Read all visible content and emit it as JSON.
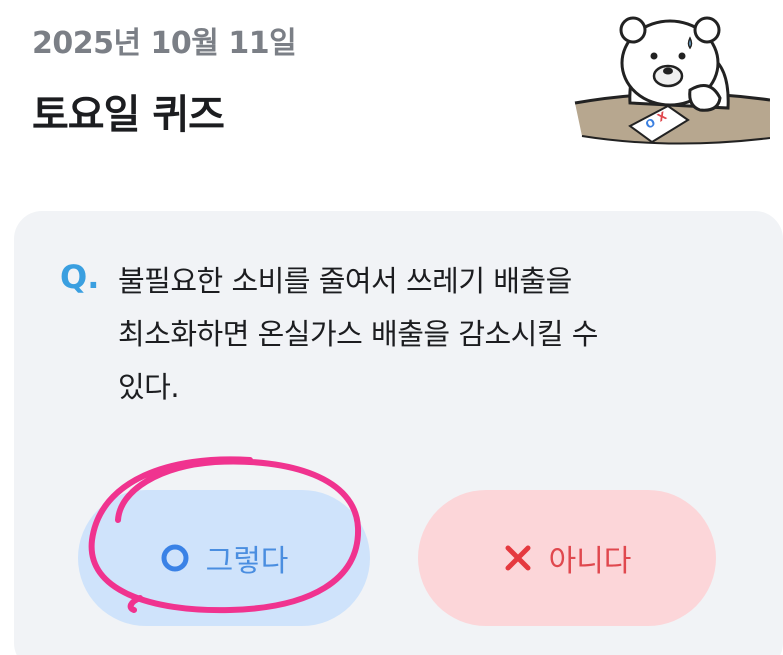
{
  "header": {
    "date": "2025년 10월 11일",
    "title": "토요일 퀴즈"
  },
  "quiz": {
    "q_label": "Q.",
    "question": "불필요한 소비를 줄여서 쓰레기 배출을\n최소화하면 온실가스 배출을 감소시킬 수\n있다.",
    "answers": [
      {
        "label": "그렇다",
        "icon": "circle-o-icon",
        "color": "#4a8ee0",
        "bg": "#cfe3fb"
      },
      {
        "label": "아니다",
        "icon": "x-mark-icon",
        "color": "#e0484e",
        "bg": "#fcd6d9"
      }
    ]
  },
  "mascot": {
    "icon": "polar-bear-icon",
    "card_text": "OX"
  },
  "annotation": {
    "color": "#f0338f"
  }
}
